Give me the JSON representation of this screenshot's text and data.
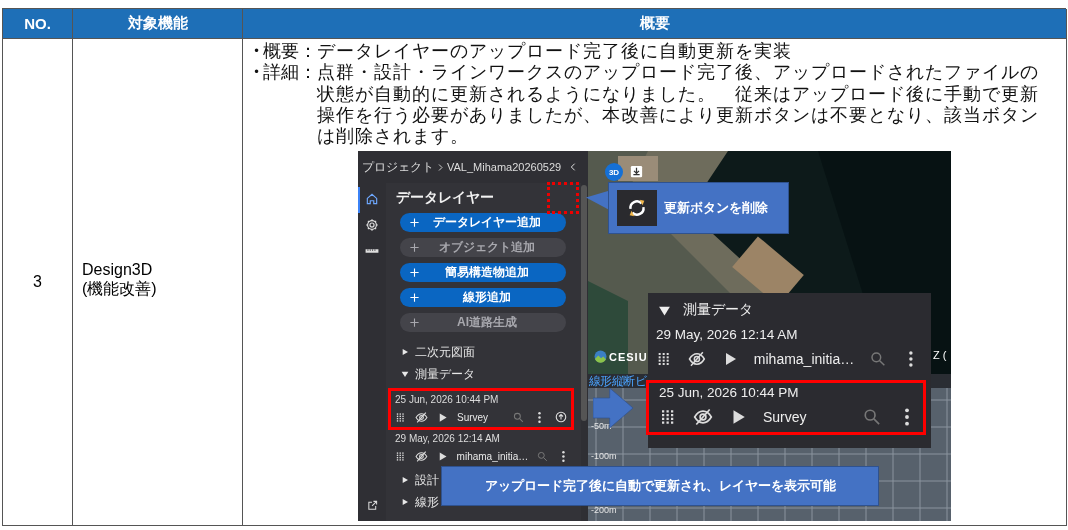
{
  "table": {
    "columns": [
      {
        "label": "NO."
      },
      {
        "label": "対象機能"
      },
      {
        "label": "概要"
      }
    ],
    "rows": [
      {
        "no": "3",
        "feature": [
          "Design3D",
          "(機能改善)"
        ],
        "bullets": [
          {
            "marker": "•",
            "label": "概要：",
            "text": "データレイヤーのアップロード完了後に自動更新を実装"
          },
          {
            "marker": "•",
            "label": "詳細：",
            "text": "点群・設計・ラインワークスのアップロード完了後、アップロードされたファイルの状態が自動的に更新されるようになりました。　従来はアップロード後に手動で更新操作を行う必要がありましたが、本改善により更新ボタンは不要となり、該当ボタンは削除されます。"
          }
        ],
        "screenshot": {
          "breadcrumb": {
            "project": "プロジェクト",
            "name": "VAL_Mihama20260529"
          },
          "rail": [
            {
              "kind": "home",
              "selected": true
            },
            {
              "kind": "gear",
              "selected": false
            },
            {
              "kind": "ruler",
              "selected": false
            }
          ],
          "panel_title": "データレイヤー",
          "buttons": [
            {
              "label": "データレイヤー追加",
              "disabled": false
            },
            {
              "label": "オブジェクト追加",
              "disabled": true
            },
            {
              "label": "簡易構造物追加",
              "disabled": false
            },
            {
              "label": "線形追加",
              "disabled": false
            },
            {
              "label": "AI道路生成",
              "disabled": true
            }
          ],
          "tree": [
            {
              "label": "二次元図面",
              "expanded": false
            },
            {
              "label": "測量データ",
              "expanded": true,
              "children": [
                {
                  "date": "25 Jun, 2026 10:44 PM",
                  "name": "Survey",
                  "highlighted": true,
                  "upload": true
                },
                {
                  "date": "29 May, 2026 12:14 AM",
                  "name": "mihama_initia…",
                  "highlighted": false,
                  "upload": false
                }
              ]
            },
            {
              "label": "設計",
              "expanded": false
            },
            {
              "label": "線形",
              "expanded": false
            }
          ],
          "map": {
            "view_button": "3D",
            "attribution": "CESIU",
            "edge_text": "Z (",
            "profile_tab": "線形縦断ビ",
            "axis_labels": [
              "-50m",
              "-100m",
              "-200m"
            ]
          },
          "callouts": [
            {
              "kind": "removed",
              "text": "更新ボタンを削除"
            },
            {
              "kind": "note",
              "text": "アップロード完了後に自動で更新され、レイヤーを表示可能"
            }
          ],
          "zoom_popup": {
            "label": "測量データ",
            "expanded": true,
            "children": [
              {
                "date": "29 May, 2026 12:14 AM",
                "name": "mihama_initia…",
                "highlighted": false
              },
              {
                "date": "25 Jun, 2026 10:44 PM",
                "name": "Survey",
                "highlighted": true
              }
            ]
          }
        }
      }
    ]
  }
}
